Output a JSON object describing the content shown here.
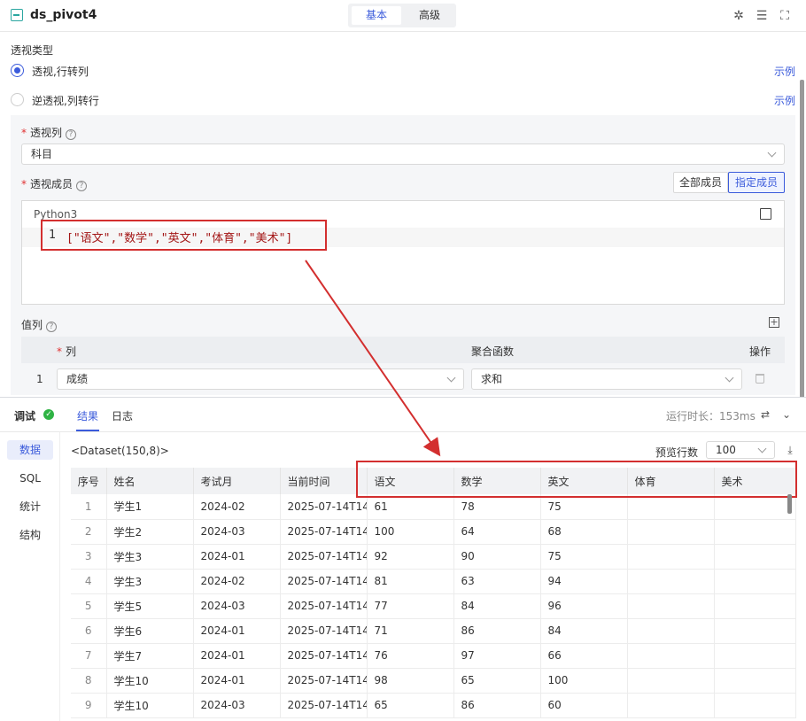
{
  "header": {
    "title": "ds_pivot4",
    "tabs": [
      "基本",
      "高级"
    ]
  },
  "pivot": {
    "type_label": "透视类型",
    "options": [
      {
        "label": "透视,行转列",
        "link": "示例"
      },
      {
        "label": "逆透视,列转行",
        "link": "示例"
      }
    ],
    "pivot_column_label": "透视列",
    "pivot_column_value": "科目",
    "members_label": "透视成员",
    "member_buttons": [
      "全部成员",
      "指定成员"
    ],
    "editor_lang": "Python3",
    "code_line_number": "1",
    "code": "[\"语文\",\"数学\",\"英文\",\"体育\",\"美术\"]",
    "value_columns_label": "值列",
    "grid_headers": {
      "column": "列",
      "agg": "聚合函数",
      "ops": "操作"
    },
    "grid_row": {
      "index": "1",
      "column": "成绩",
      "agg": "求和"
    }
  },
  "debug": {
    "title": "调试",
    "tabs": [
      "结果",
      "日志"
    ],
    "runtime": "运行时长：153ms",
    "nav": [
      "数据",
      "SQL",
      "统计",
      "结构"
    ],
    "dataset": "<Dataset(150,8)>",
    "preview_label": "预览行数",
    "preview_value": "100"
  },
  "table": {
    "headers": [
      "序号",
      "姓名",
      "考试月",
      "当前时间",
      "语文",
      "数学",
      "英文",
      "体育",
      "美术"
    ],
    "rows": [
      [
        "1",
        "学生1",
        "2024-02",
        "2025-07-14T14",
        "61",
        "78",
        "75",
        "",
        ""
      ],
      [
        "2",
        "学生2",
        "2024-03",
        "2025-07-14T14",
        "100",
        "64",
        "68",
        "",
        ""
      ],
      [
        "3",
        "学生3",
        "2024-01",
        "2025-07-14T14",
        "92",
        "90",
        "75",
        "",
        ""
      ],
      [
        "4",
        "学生3",
        "2024-02",
        "2025-07-14T14",
        "81",
        "63",
        "94",
        "",
        ""
      ],
      [
        "5",
        "学生5",
        "2024-03",
        "2025-07-14T14",
        "77",
        "84",
        "96",
        "",
        ""
      ],
      [
        "6",
        "学生6",
        "2024-01",
        "2025-07-14T14",
        "71",
        "86",
        "84",
        "",
        ""
      ],
      [
        "7",
        "学生7",
        "2024-01",
        "2025-07-14T14",
        "76",
        "97",
        "66",
        "",
        ""
      ],
      [
        "8",
        "学生10",
        "2024-01",
        "2025-07-14T14",
        "98",
        "65",
        "100",
        "",
        ""
      ],
      [
        "9",
        "学生10",
        "2024-03",
        "2025-07-14T14",
        "65",
        "86",
        "60",
        "",
        ""
      ]
    ]
  },
  "colors": {
    "accent": "#3b5bdb",
    "annotation": "#d32f2f",
    "success": "#2fb344"
  }
}
